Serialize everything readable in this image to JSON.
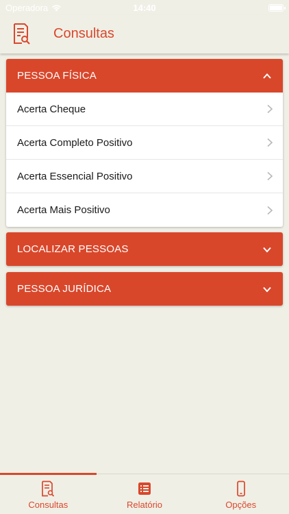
{
  "status_bar": {
    "carrier": "Operadora",
    "time": "14:40"
  },
  "header": {
    "title": "Consultas",
    "icon": "document-search-icon"
  },
  "sections": [
    {
      "title": "PESSOA FÍSICA",
      "expanded": true,
      "items": [
        {
          "label": "Acerta Cheque"
        },
        {
          "label": "Acerta Completo Positivo"
        },
        {
          "label": "Acerta Essencial Positivo"
        },
        {
          "label": "Acerta Mais Positivo"
        }
      ]
    },
    {
      "title": "LOCALIZAR PESSOAS",
      "expanded": false,
      "items": []
    },
    {
      "title": "PESSOA JURÍDICA",
      "expanded": false,
      "items": []
    }
  ],
  "tab_bar": {
    "tabs": [
      {
        "label": "Consultas",
        "icon": "document-search-icon",
        "active": true
      },
      {
        "label": "Relatório",
        "icon": "list-icon",
        "active": false
      },
      {
        "label": "Opções",
        "icon": "phone-icon",
        "active": false
      }
    ]
  },
  "colors": {
    "accent": "#d9472b",
    "background": "#f0efe6",
    "card": "#ffffff"
  }
}
